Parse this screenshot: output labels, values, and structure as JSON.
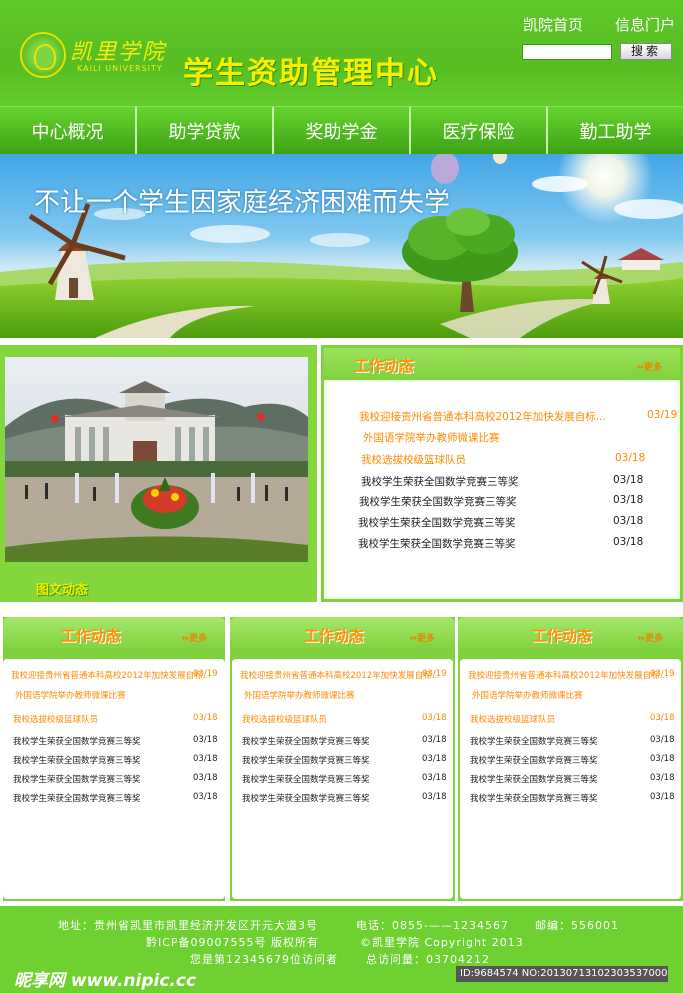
{
  "header": {
    "logo_cn": "凯里学院",
    "logo_en": "KAILI UNIVERSITY",
    "title": "学生资助管理中心",
    "links": [
      "凯院首页",
      "信息门户"
    ],
    "search_placeholder": "",
    "search_button": "搜索"
  },
  "nav": [
    "中心概况",
    "助学贷款",
    "奖助学金",
    "医疗保险",
    "勤工助学"
  ],
  "banner": {
    "slogan": "不让一个学生因家庭经济困难而失学"
  },
  "intro": {
    "caption": "图文动态"
  },
  "main_news": {
    "title": "工作动态",
    "more": "更多",
    "items": [
      {
        "title": "我校迎接贵州省普通本科高校2012年加快发展自标...",
        "date": "03/19",
        "color": "#ff8a00"
      },
      {
        "title": "外国语学院举办教师微课比赛",
        "date": "",
        "color": "#ff8a00"
      },
      {
        "title": "我校选拔校级篮球队员",
        "date": "03/18",
        "color": "#ff8a00"
      },
      {
        "title": "我校学生荣获全国数学竞赛三等奖",
        "date": "03/18",
        "color": "#222222"
      },
      {
        "title": "我校学生荣获全国数学竞赛三等奖",
        "date": "03/18",
        "color": "#222222"
      },
      {
        "title": "我校学生荣获全国数学竞赛三等奖",
        "date": "03/18",
        "color": "#222222"
      },
      {
        "title": "我校学生荣获全国数学竞赛三等奖",
        "date": "03/18",
        "color": "#222222"
      }
    ]
  },
  "small_panels": [
    {
      "title": "工作动态",
      "more": "更多",
      "items": [
        {
          "title": "我校迎接贵州省普通本科高校2012年加快发展自标...",
          "date": "03/19",
          "color": "#ff8a00"
        },
        {
          "title": "外国语学院举办教师微课比赛",
          "date": "",
          "color": "#ff8a00"
        },
        {
          "title": "我校选拔校级篮球队员",
          "date": "03/18",
          "color": "#ff8a00"
        },
        {
          "title": "我校学生荣获全国数学竞赛三等奖",
          "date": "03/18",
          "color": "#222222"
        },
        {
          "title": "我校学生荣获全国数学竞赛三等奖",
          "date": "03/18",
          "color": "#222222"
        },
        {
          "title": "我校学生荣获全国数学竞赛三等奖",
          "date": "03/18",
          "color": "#222222"
        },
        {
          "title": "我校学生荣获全国数学竞赛三等奖",
          "date": "03/18",
          "color": "#222222"
        }
      ]
    },
    {
      "title": "工作动态",
      "more": "更多",
      "items": [
        {
          "title": "我校迎接贵州省普通本科高校2012年加快发展自标...",
          "date": "03/19",
          "color": "#ff8a00"
        },
        {
          "title": "外国语学院举办教师微课比赛",
          "date": "",
          "color": "#ff8a00"
        },
        {
          "title": "我校选拔校级篮球队员",
          "date": "03/18",
          "color": "#ff8a00"
        },
        {
          "title": "我校学生荣获全国数学竞赛三等奖",
          "date": "03/18",
          "color": "#222222"
        },
        {
          "title": "我校学生荣获全国数学竞赛三等奖",
          "date": "03/18",
          "color": "#222222"
        },
        {
          "title": "我校学生荣获全国数学竞赛三等奖",
          "date": "03/18",
          "color": "#222222"
        },
        {
          "title": "我校学生荣获全国数学竞赛三等奖",
          "date": "03/18",
          "color": "#222222"
        }
      ]
    },
    {
      "title": "工作动态",
      "more": "更多",
      "items": [
        {
          "title": "我校迎接贵州省普通本科高校2012年加快发展自标...",
          "date": "03/19",
          "color": "#ff8a00"
        },
        {
          "title": "外国语学院举办教师微课比赛",
          "date": "",
          "color": "#ff8a00"
        },
        {
          "title": "我校选拔校级篮球队员",
          "date": "03/18",
          "color": "#ff8a00"
        },
        {
          "title": "我校学生荣获全国数学竞赛三等奖",
          "date": "03/18",
          "color": "#222222"
        },
        {
          "title": "我校学生荣获全国数学竞赛三等奖",
          "date": "03/18",
          "color": "#222222"
        },
        {
          "title": "我校学生荣获全国数学竞赛三等奖",
          "date": "03/18",
          "color": "#222222"
        },
        {
          "title": "我校学生荣获全国数学竞赛三等奖",
          "date": "03/18",
          "color": "#222222"
        }
      ]
    }
  ],
  "footer": {
    "address": "地址：贵州省凯里市凯里经济开发区开元大道3号",
    "phone": "电话：0855-——1234567",
    "postcode": "邮编：556001",
    "icp": "黔ICP备09007555号 版权所有",
    "copyright": "©凯里学院 Copyright 2013",
    "visitor": "您是第12345679位访问者",
    "total": "总访问量：03704212"
  },
  "watermark": {
    "site": "昵享网 www.nipic.cc",
    "id": "ID:9684574 NO:20130713102303537000"
  }
}
